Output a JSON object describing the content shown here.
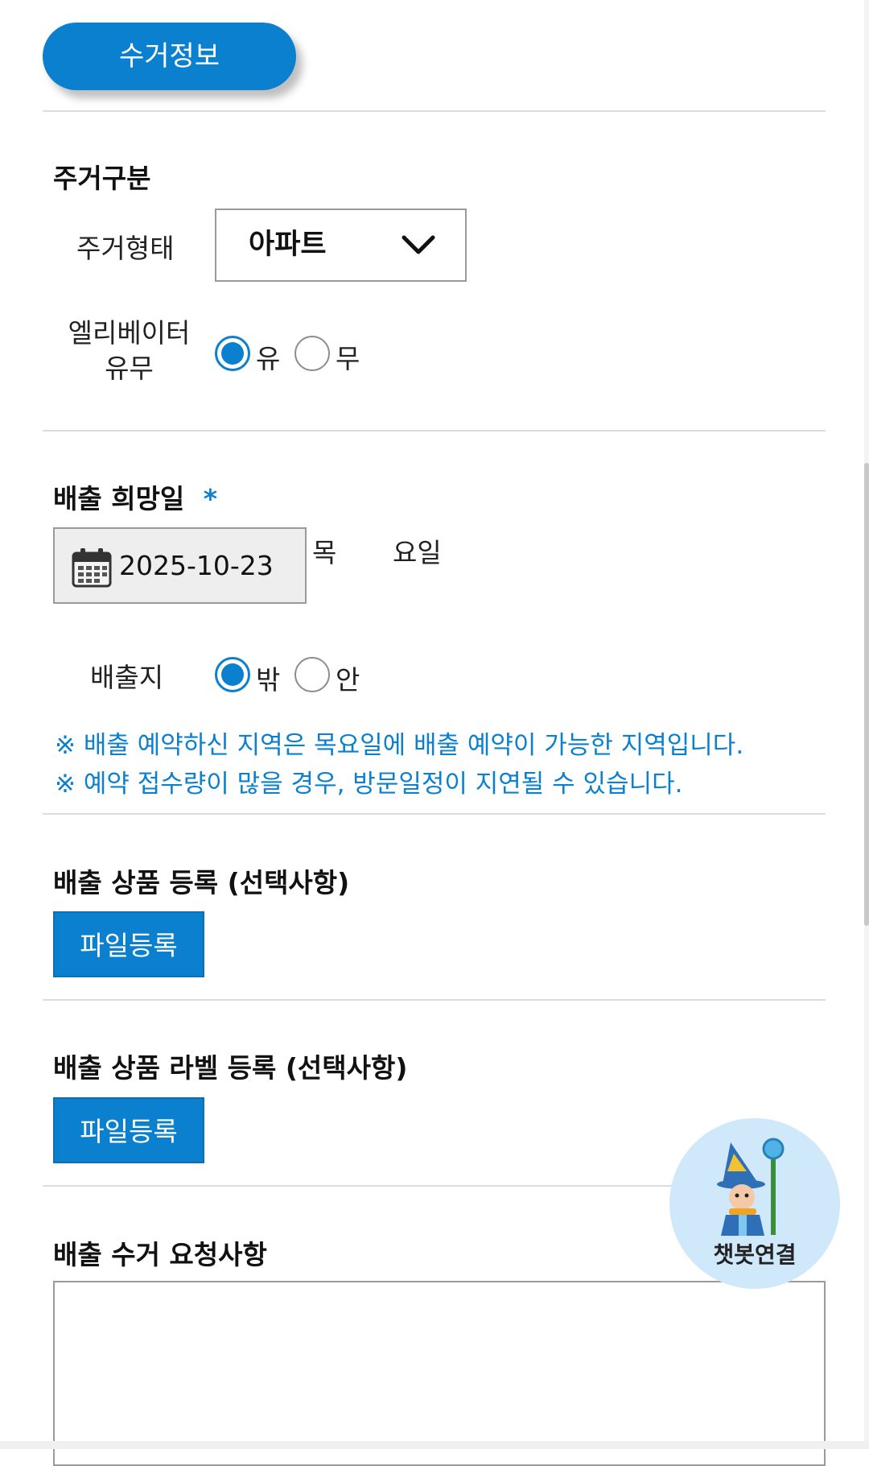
{
  "header": {
    "tag_label": "수거정보"
  },
  "housing": {
    "section_title": "주거구분",
    "type_label": "주거형태",
    "type_value": "아파트",
    "elevator_label_line1": "엘리베이터",
    "elevator_label_line2": "유무",
    "elevator_options": [
      {
        "label": "유",
        "selected": true
      },
      {
        "label": "무",
        "selected": false
      }
    ]
  },
  "date": {
    "section_title": "배출 희망일",
    "required_mark": "*",
    "value": "2025-10-23",
    "weekday": "목",
    "weekday_suffix": "요일"
  },
  "location": {
    "label": "배출지",
    "options": [
      {
        "label": "밖",
        "selected": true
      },
      {
        "label": "안",
        "selected": false
      }
    ]
  },
  "notices": [
    "※ 배출 예약하신 지역은 목요일에 배출 예약이 가능한 지역입니다.",
    "※ 예약 접수량이 많을 경우, 방문일정이 지연될 수 있습니다."
  ],
  "product_register": {
    "section_title": "배출 상품 등록 (선택사항)",
    "button_label": "파일등록"
  },
  "label_register": {
    "section_title": "배출 상품 라벨 등록 (선택사항)",
    "button_label": "파일등록"
  },
  "request": {
    "section_title": "배출 수거 요청사항",
    "value": ""
  },
  "chatbot": {
    "label": "챗봇연결"
  },
  "colors": {
    "accent": "#0a80cf",
    "divider": "#dcdcdc",
    "chatbot_bg": "#cfe9fb"
  }
}
